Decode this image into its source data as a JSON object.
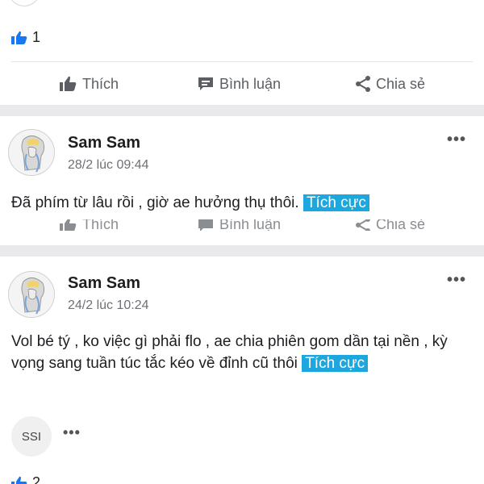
{
  "top_post": {
    "like_count": "1",
    "actions": {
      "like": "Thích",
      "comment": "Bình luận",
      "share": "Chia sẻ"
    }
  },
  "posts": [
    {
      "author": "Sam Sam",
      "time": "28/2 lúc 09:44",
      "text": "Đã phím từ lâu rồi , giờ ae hưởng thụ thôi.",
      "tag": "Tích cực",
      "more": "•••",
      "actions": {
        "like": "Thích",
        "comment": "Bình luận",
        "share": "Chia sẻ"
      }
    },
    {
      "author": "Sam Sam",
      "time": "24/2 lúc 10:24",
      "text": "Vol bé tý , ko việc gì phải flo , ae chia phiên gom dần tại nền , kỳ vọng sang tuần túc tắc kéo về đỉnh cũ thôi",
      "tag": "Tích cực",
      "more": "•••",
      "stock_badge": "SSI",
      "stock_more": "•••",
      "like_count": "2"
    }
  ],
  "colors": {
    "accent": "#1ea7df",
    "like_blue": "#1877f2",
    "gap": "#e9e9eb"
  }
}
